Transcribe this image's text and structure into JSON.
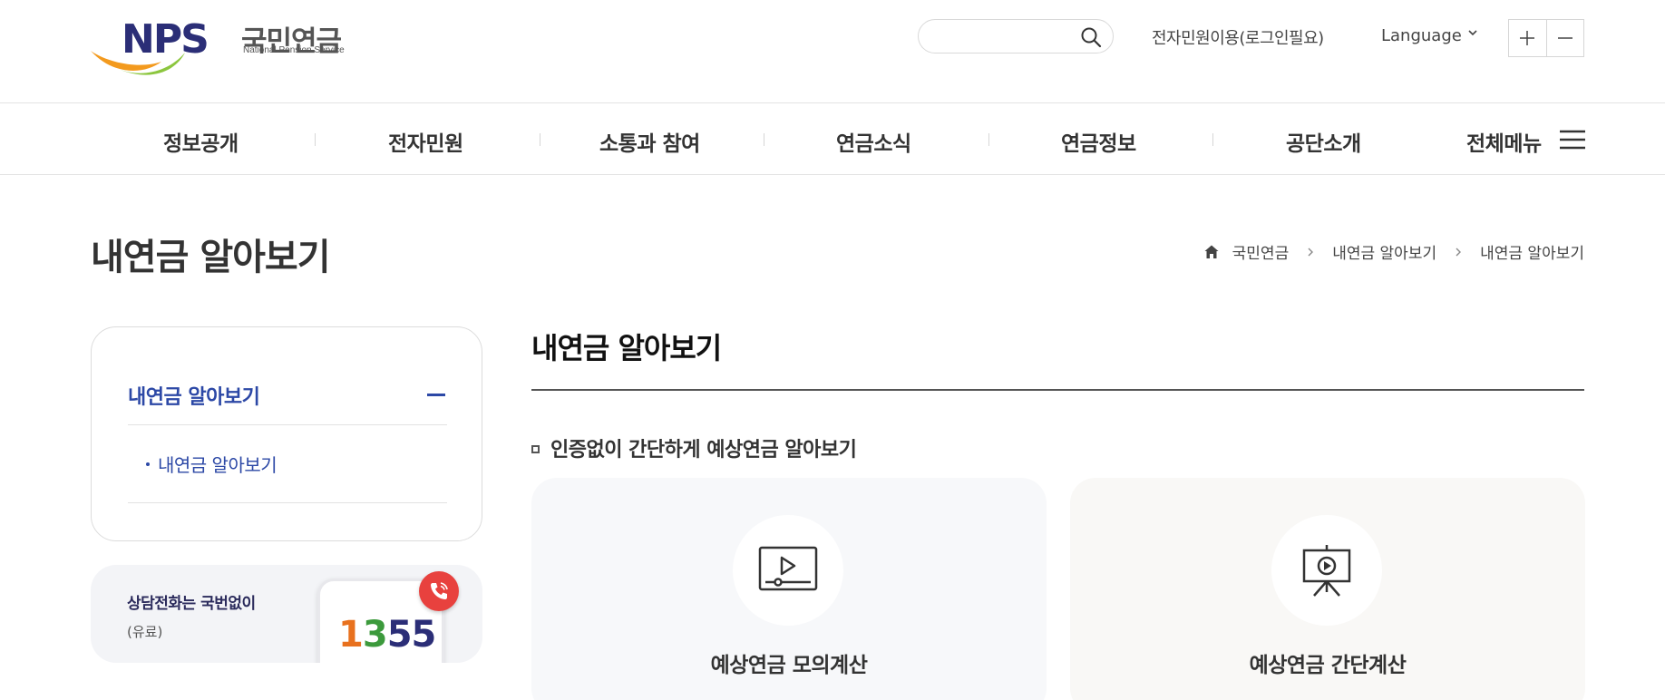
{
  "header": {
    "logo": {
      "mark": "NPS",
      "name_ko": "국민연금",
      "name_en": "National Pension Service"
    },
    "search": {
      "placeholder": "",
      "value": ""
    },
    "login_link": "전자민원이용(로그인필요)",
    "language_label": "Language",
    "zoom": {
      "in_symbol": "+",
      "out_symbol": "−"
    }
  },
  "gnb": {
    "items": [
      {
        "label": "정보공개"
      },
      {
        "label": "전자민원"
      },
      {
        "label": "소통과 참여"
      },
      {
        "label": "연금소식"
      },
      {
        "label": "연금정보"
      },
      {
        "label": "공단소개"
      }
    ],
    "all_menu_label": "전체메뉴"
  },
  "page": {
    "title": "내연금 알아보기",
    "breadcrumb": [
      "국민연금",
      "내연금 알아보기",
      "내연금 알아보기"
    ]
  },
  "lnb": {
    "title": "내연금 알아보기",
    "sub_items": [
      {
        "label": "내연금 알아보기"
      }
    ]
  },
  "call_banner": {
    "title": "상담전화는 국번없이",
    "subtitle": "(유료)",
    "number_parts": [
      "1",
      "3",
      "55"
    ]
  },
  "main": {
    "title": "내연금 알아보기",
    "section_heading": "인증없이 간단하게 예상연금 알아보기",
    "cards": [
      {
        "label": "예상연금 모의계산",
        "icon": "video-play-icon"
      },
      {
        "label": "예상연금 간단계산",
        "icon": "presentation-play-icon"
      }
    ]
  },
  "colors": {
    "accent_blue": "#2c48a6",
    "logo_navy": "#2b2e77",
    "logo_orange": "#e8711e",
    "logo_green": "#8cc63e",
    "call_red": "#e8413e"
  }
}
